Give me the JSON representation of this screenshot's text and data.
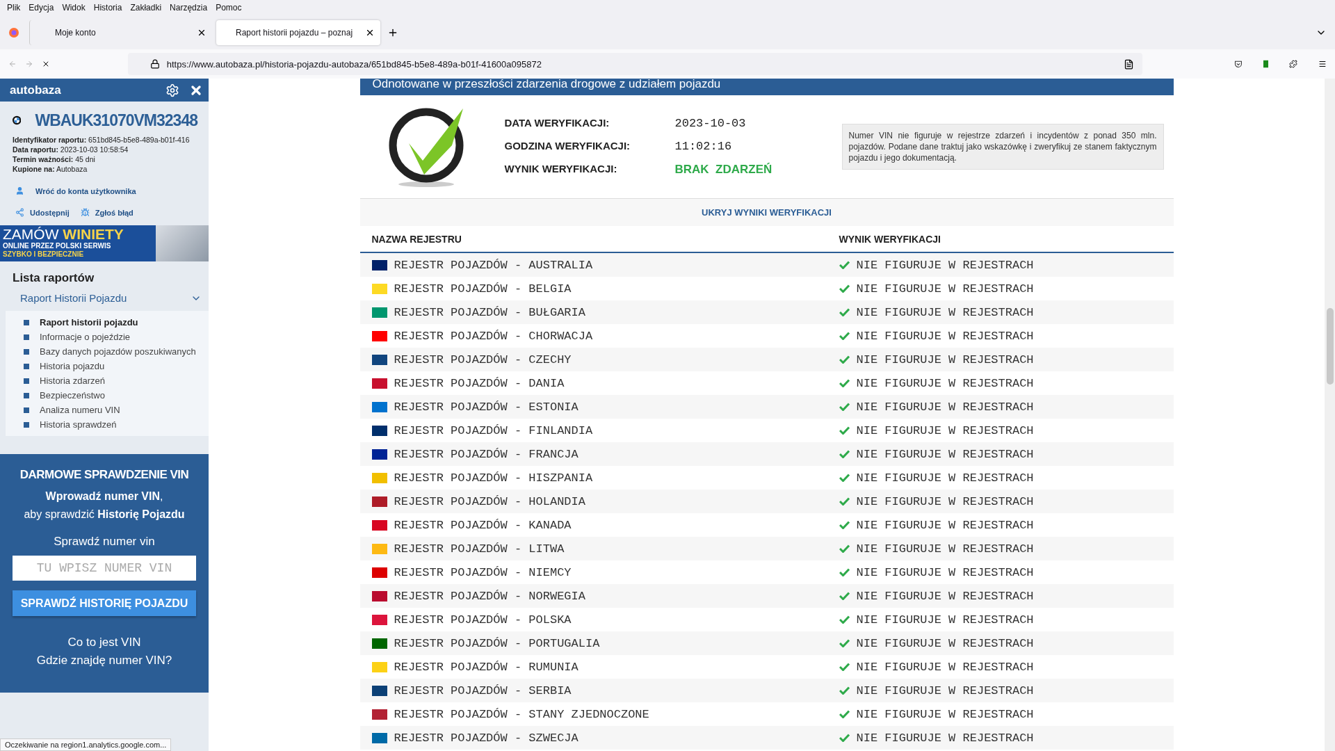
{
  "browser": {
    "menu": [
      "Plik",
      "Edycja",
      "Widok",
      "Historia",
      "Zakładki",
      "Narzędzia",
      "Pomoc"
    ],
    "tabs": [
      {
        "title": "Moje konto",
        "selected": false
      },
      {
        "title": "Raport historii pojazdu – poznaj",
        "selected": true
      }
    ],
    "url": "https://www.autobaza.pl/historia-pojazdu-autobaza/651bd845-b5e8-489a-b01f-41600a095872"
  },
  "sidebar": {
    "brand": "autobaza",
    "vin": "WBAUK31070VM32348",
    "meta": [
      {
        "label": "Identyfikator raportu:",
        "value": "651bd845-b5e8-489a-b01f-416"
      },
      {
        "label": "Data raportu:",
        "value": "2023-10-03 10:58:54"
      },
      {
        "label": "Termin ważności:",
        "value": "45 dni"
      },
      {
        "label": "Kupione na:",
        "value": "Autobaza"
      }
    ],
    "links": [
      {
        "text": "Wróć do konta użytkownika",
        "kind": "user"
      },
      {
        "text": "Udostępnij",
        "kind": "share"
      },
      {
        "text": "Zgłoś błąd",
        "kind": "bug"
      }
    ],
    "banner": {
      "title": "ZAMÓW",
      "highlight": "WINIETY",
      "line1": "ONLINE PRZEZ POLSKI SERWIS",
      "line2": "SZYBKO I BEZPIECZNIE"
    },
    "reports_title": "Lista raportów",
    "group": {
      "title": "Raport Historii Pojazdu",
      "expanded": true,
      "items": [
        {
          "label": "Raport historii pojazdu",
          "selected": true
        },
        {
          "label": "Informacje o pojeździe",
          "selected": false
        },
        {
          "label": "Bazy danych pojazdów poszukiwanych",
          "selected": false
        },
        {
          "label": "Historia pojazdu",
          "selected": false
        },
        {
          "label": "Historia zdarzeń",
          "selected": false
        },
        {
          "label": "Bezpieczeństwo",
          "selected": false
        },
        {
          "label": "Analiza numeru VIN",
          "selected": false
        },
        {
          "label": "Historia sprawdzeń",
          "selected": false
        }
      ]
    },
    "promo": {
      "heading": "DARMOWE SPRAWDZENIE VIN",
      "line1": "**Wprowadź numer VIN**,",
      "line2": "aby sprawdzić **Historię Pojazdu**",
      "label": "Sprawdź numer vin",
      "placeholder": "TU WPISZ NUMER VIN",
      "button": "SPRAWDŹ HISTORIĘ POJAZDU",
      "links": [
        "Co to jest VIN",
        "Gdzie znajdę numer VIN?"
      ]
    }
  },
  "main": {
    "section_title": "Odnotowane w przeszłości zdarzenia drogowe z udziałem pojazdu",
    "verification": [
      {
        "label": "DATA WERYFIKACJI:",
        "value": "2023-10-03",
        "kind": "plain"
      },
      {
        "label": "GODZINA WERYFIKACJI:",
        "value": "11:02:16",
        "kind": "plain"
      },
      {
        "label": "WYNIK WERYFIKACJI:",
        "value": "BRAK  ZDARZEŃ",
        "kind": "result"
      }
    ],
    "note": "Numer VIN nie figuruje w rejestrze zdarzeń i incydentów z ponad 350 mln. pojazdów. Podane dane traktuj jako wskazówkę i zweryfikuj ze stanem faktycznym pojazdu i jego dokumentacją.",
    "toggle": "UKRYJ WYNIKI WERYFIKACJI",
    "columns": [
      "NAZWA REJESTRU",
      "WYNIK WERYFIKACJI"
    ],
    "rows": [
      {
        "name": "REJESTR POJAZDÓW - AUSTRALIA",
        "result": "NIE FIGURUJE W REJESTRACH",
        "color": "#012169"
      },
      {
        "name": "REJESTR POJAZDÓW - BELGIA",
        "result": "NIE FIGURUJE W REJESTRACH",
        "color": "#fdda24"
      },
      {
        "name": "REJESTR POJAZDÓW - BUŁGARIA",
        "result": "NIE FIGURUJE W REJESTRACH",
        "color": "#00966e"
      },
      {
        "name": "REJESTR POJAZDÓW - CHORWACJA",
        "result": "NIE FIGURUJE W REJESTRACH",
        "color": "#ff0000"
      },
      {
        "name": "REJESTR POJAZDÓW - CZECHY",
        "result": "NIE FIGURUJE W REJESTRACH",
        "color": "#11457e"
      },
      {
        "name": "REJESTR POJAZDÓW - DANIA",
        "result": "NIE FIGURUJE W REJESTRACH",
        "color": "#c8102e"
      },
      {
        "name": "REJESTR POJAZDÓW - ESTONIA",
        "result": "NIE FIGURUJE W REJESTRACH",
        "color": "#0072ce"
      },
      {
        "name": "REJESTR POJAZDÓW - FINLANDIA",
        "result": "NIE FIGURUJE W REJESTRACH",
        "color": "#002f6c"
      },
      {
        "name": "REJESTR POJAZDÓW - FRANCJA",
        "result": "NIE FIGURUJE W REJESTRACH",
        "color": "#002395"
      },
      {
        "name": "REJESTR POJAZDÓW - HISZPANIA",
        "result": "NIE FIGURUJE W REJESTRACH",
        "color": "#f1bf00"
      },
      {
        "name": "REJESTR POJAZDÓW - HOLANDIA",
        "result": "NIE FIGURUJE W REJESTRACH",
        "color": "#ae1c28"
      },
      {
        "name": "REJESTR POJAZDÓW - KANADA",
        "result": "NIE FIGURUJE W REJESTRACH",
        "color": "#d80621"
      },
      {
        "name": "REJESTR POJAZDÓW - LITWA",
        "result": "NIE FIGURUJE W REJESTRACH",
        "color": "#fdb913"
      },
      {
        "name": "REJESTR POJAZDÓW - NIEMCY",
        "result": "NIE FIGURUJE W REJESTRACH",
        "color": "#dd0000"
      },
      {
        "name": "REJESTR POJAZDÓW - NORWEGIA",
        "result": "NIE FIGURUJE W REJESTRACH",
        "color": "#ba0c2f"
      },
      {
        "name": "REJESTR POJAZDÓW - POLSKA",
        "result": "NIE FIGURUJE W REJESTRACH",
        "color": "#dc143c"
      },
      {
        "name": "REJESTR POJAZDÓW - PORTUGALIA",
        "result": "NIE FIGURUJE W REJESTRACH",
        "color": "#006600"
      },
      {
        "name": "REJESTR POJAZDÓW - RUMUNIA",
        "result": "NIE FIGURUJE W REJESTRACH",
        "color": "#fcd116"
      },
      {
        "name": "REJESTR POJAZDÓW - SERBIA",
        "result": "NIE FIGURUJE W REJESTRACH",
        "color": "#0c4076"
      },
      {
        "name": "REJESTR POJAZDÓW - STANY ZJEDNOCZONE",
        "result": "NIE FIGURUJE W REJESTRACH",
        "color": "#b22234"
      },
      {
        "name": "REJESTR POJAZDÓW - SZWECJA",
        "result": "NIE FIGURUJE W REJESTRACH",
        "color": "#006aa7"
      }
    ]
  },
  "status_bar": "Oczekiwanie na region1.analytics.google.com..."
}
